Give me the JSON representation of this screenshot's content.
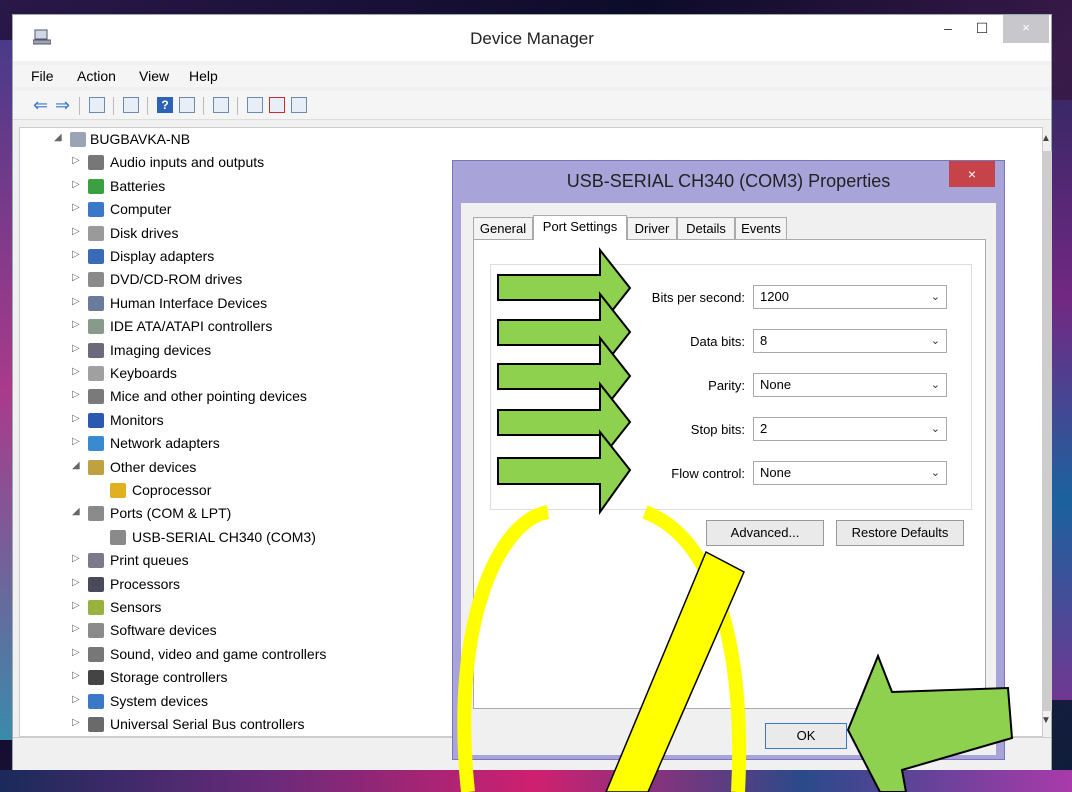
{
  "window": {
    "title": "Device Manager",
    "min_glyph": "–",
    "max_glyph": "☐",
    "close_glyph": "×"
  },
  "menu": [
    "File",
    "Action",
    "View",
    "Help"
  ],
  "tree": {
    "root": "BUGBAVKA-NB",
    "items": [
      {
        "label": "Audio inputs and outputs",
        "icon": "speaker-icon",
        "color": "#777777"
      },
      {
        "label": "Batteries",
        "icon": "battery-icon",
        "color": "#3aa040"
      },
      {
        "label": "Computer",
        "icon": "computer-icon",
        "color": "#3a78c8"
      },
      {
        "label": "Disk drives",
        "icon": "disk-icon",
        "color": "#9a9a9a"
      },
      {
        "label": "Display adapters",
        "icon": "display-icon",
        "color": "#3a6ab8"
      },
      {
        "label": "DVD/CD-ROM drives",
        "icon": "dvd-icon",
        "color": "#8a8a8a"
      },
      {
        "label": "Human Interface Devices",
        "icon": "hid-icon",
        "color": "#6a7a9a"
      },
      {
        "label": "IDE ATA/ATAPI controllers",
        "icon": "ide-icon",
        "color": "#8a9a8a"
      },
      {
        "label": "Imaging devices",
        "icon": "camera-icon",
        "color": "#6a6a7a"
      },
      {
        "label": "Keyboards",
        "icon": "keyboard-icon",
        "color": "#a0a0a0"
      },
      {
        "label": "Mice and other pointing devices",
        "icon": "mouse-icon",
        "color": "#7a7a7a"
      },
      {
        "label": "Monitors",
        "icon": "monitor-icon",
        "color": "#2a5ab0"
      },
      {
        "label": "Network adapters",
        "icon": "network-icon",
        "color": "#3a8ad0"
      },
      {
        "label": "Other devices",
        "icon": "unknown-device-icon",
        "color": "#c0a040",
        "expanded": true
      },
      {
        "label": "Coprocessor",
        "icon": "warning-device-icon",
        "color": "#e0b020",
        "child": true
      },
      {
        "label": "Ports (COM & LPT)",
        "icon": "port-icon",
        "color": "#8a8a8a",
        "expanded": true
      },
      {
        "label": "USB-SERIAL CH340 (COM3)",
        "icon": "port-icon",
        "color": "#8a8a8a",
        "child": true
      },
      {
        "label": "Print queues",
        "icon": "printer-icon",
        "color": "#7a7a8a"
      },
      {
        "label": "Processors",
        "icon": "cpu-icon",
        "color": "#4a4a5a"
      },
      {
        "label": "Sensors",
        "icon": "sensor-icon",
        "color": "#9ab040"
      },
      {
        "label": "Software devices",
        "icon": "software-icon",
        "color": "#8a8a8a"
      },
      {
        "label": "Sound, video and game controllers",
        "icon": "sound-icon",
        "color": "#777777"
      },
      {
        "label": "Storage controllers",
        "icon": "storage-icon",
        "color": "#444444"
      },
      {
        "label": "System devices",
        "icon": "system-icon",
        "color": "#3a78c8"
      },
      {
        "label": "Universal Serial Bus controllers",
        "icon": "usb-icon",
        "color": "#6a6a6a"
      }
    ]
  },
  "dialog": {
    "title": "USB-SERIAL CH340 (COM3) Properties",
    "close_glyph": "×",
    "tabs": [
      "General",
      "Port Settings",
      "Driver",
      "Details",
      "Events"
    ],
    "active_tab": "Port Settings",
    "fields": [
      {
        "label": "Bits per second:",
        "value": "1200"
      },
      {
        "label": "Data bits:",
        "value": "8"
      },
      {
        "label": "Parity:",
        "value": "None"
      },
      {
        "label": "Stop bits:",
        "value": "2"
      },
      {
        "label": "Flow control:",
        "value": "None"
      }
    ],
    "advanced_label": "Advanced...",
    "restore_label": "Restore Defaults",
    "ok_label": "OK"
  },
  "colors": {
    "annotation_green": "#8ed14f",
    "annotation_yellow": "#ffff00",
    "dialog_frame": "#a8a3d8",
    "dialog_close": "#c7434a"
  }
}
